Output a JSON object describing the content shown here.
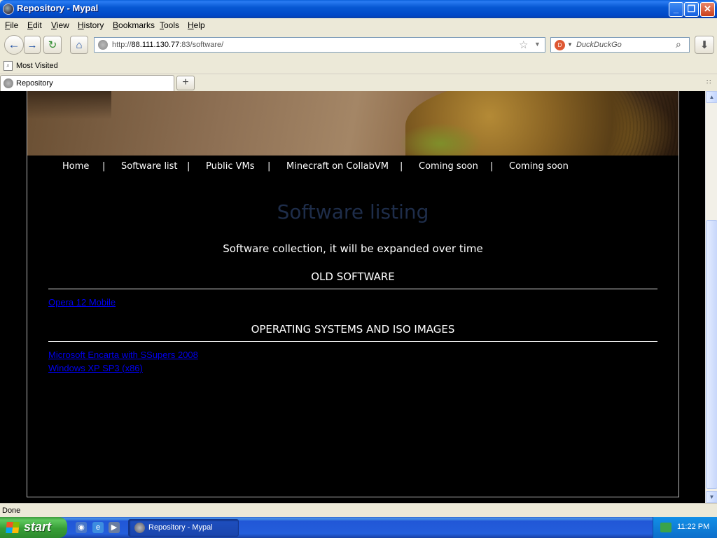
{
  "window": {
    "title": "Repository - Mypal",
    "minimize": "_",
    "maximize": "❐",
    "close": "✕"
  },
  "menu": [
    "File",
    "Edit",
    "View",
    "History",
    "Bookmarks",
    "Tools",
    "Help"
  ],
  "toolbar": {
    "url_prefix": "http://",
    "url_host": "88.111.130.77",
    "url_rest": ":83/software/",
    "search_placeholder": "DuckDuckGo"
  },
  "bookmarks": {
    "most_visited": "Most Visited"
  },
  "tabs": [
    {
      "label": "Repository"
    }
  ],
  "site": {
    "nav": [
      "Home",
      "Software list",
      "Public VMs",
      "Minecraft on CollabVM",
      "Coming soon",
      "Coming soon"
    ],
    "separator": "|",
    "page_title": "Software listing",
    "subtitle": "Software collection, it will be expanded over time",
    "sections": [
      {
        "heading": "OLD SOFTWARE",
        "links": [
          "Opera 12 Mobile"
        ]
      },
      {
        "heading": "OPERATING SYSTEMS AND ISO IMAGES",
        "links": [
          "Microsoft Encarta with SSupers 2008",
          "Windows XP SP3 (x86)"
        ]
      }
    ]
  },
  "status": {
    "text": "Done"
  },
  "taskbar": {
    "start": "start",
    "task_label": "Repository - Mypal",
    "clock": "11:22 PM"
  },
  "colors": {
    "page_title": "#1e2d4a",
    "link": "#0000ee",
    "title_bar": "#0758d3",
    "start_button": "#379e37"
  }
}
